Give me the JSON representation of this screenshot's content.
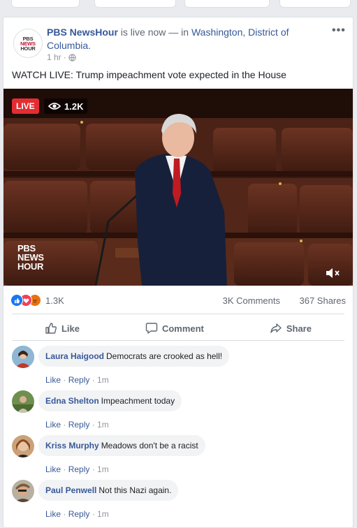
{
  "post": {
    "page_name": "PBS NewsHour",
    "status_text": " is live now — in ",
    "location": "Washington, District of Columbia.",
    "time": "1 hr",
    "separator": "·",
    "text": "WATCH LIVE: Trump impeachment vote expected in the House",
    "more": "•••",
    "logo_lines": [
      "PBS",
      "NEWS",
      "HOUR"
    ]
  },
  "video": {
    "live_label": "LIVE",
    "viewers": "1.2K",
    "watermark_lines": [
      "PBS",
      "NEWS",
      "HOUR"
    ]
  },
  "stats": {
    "reactions": "1.3K",
    "comments": "3K Comments",
    "shares": "367 Shares",
    "reaction_icons": [
      "like-icon",
      "love-icon",
      "angry-icon"
    ]
  },
  "actions": {
    "like": "Like",
    "comment": "Comment",
    "share": "Share"
  },
  "comments": [
    {
      "name": "Laura Haigood",
      "text": "Democrats are crooked as hell!",
      "like": "Like",
      "reply": "Reply",
      "time": "1m"
    },
    {
      "name": "Edna Shelton",
      "text": "Impeachment today",
      "like": "Like",
      "reply": "Reply",
      "time": "1m"
    },
    {
      "name": "Kriss Murphy",
      "text": "Meadows don't be a racist",
      "like": "Like",
      "reply": "Reply",
      "time": "1m"
    },
    {
      "name": "Paul Penwell",
      "text": "Not this Nazi again.",
      "like": "Like",
      "reply": "Reply",
      "time": "1m"
    }
  ],
  "colors": {
    "link": "#365899",
    "live_red": "#e42d32",
    "like_blue": "#1877f2",
    "love_red": "#f33e58",
    "angry_orange": "#e9710f"
  }
}
